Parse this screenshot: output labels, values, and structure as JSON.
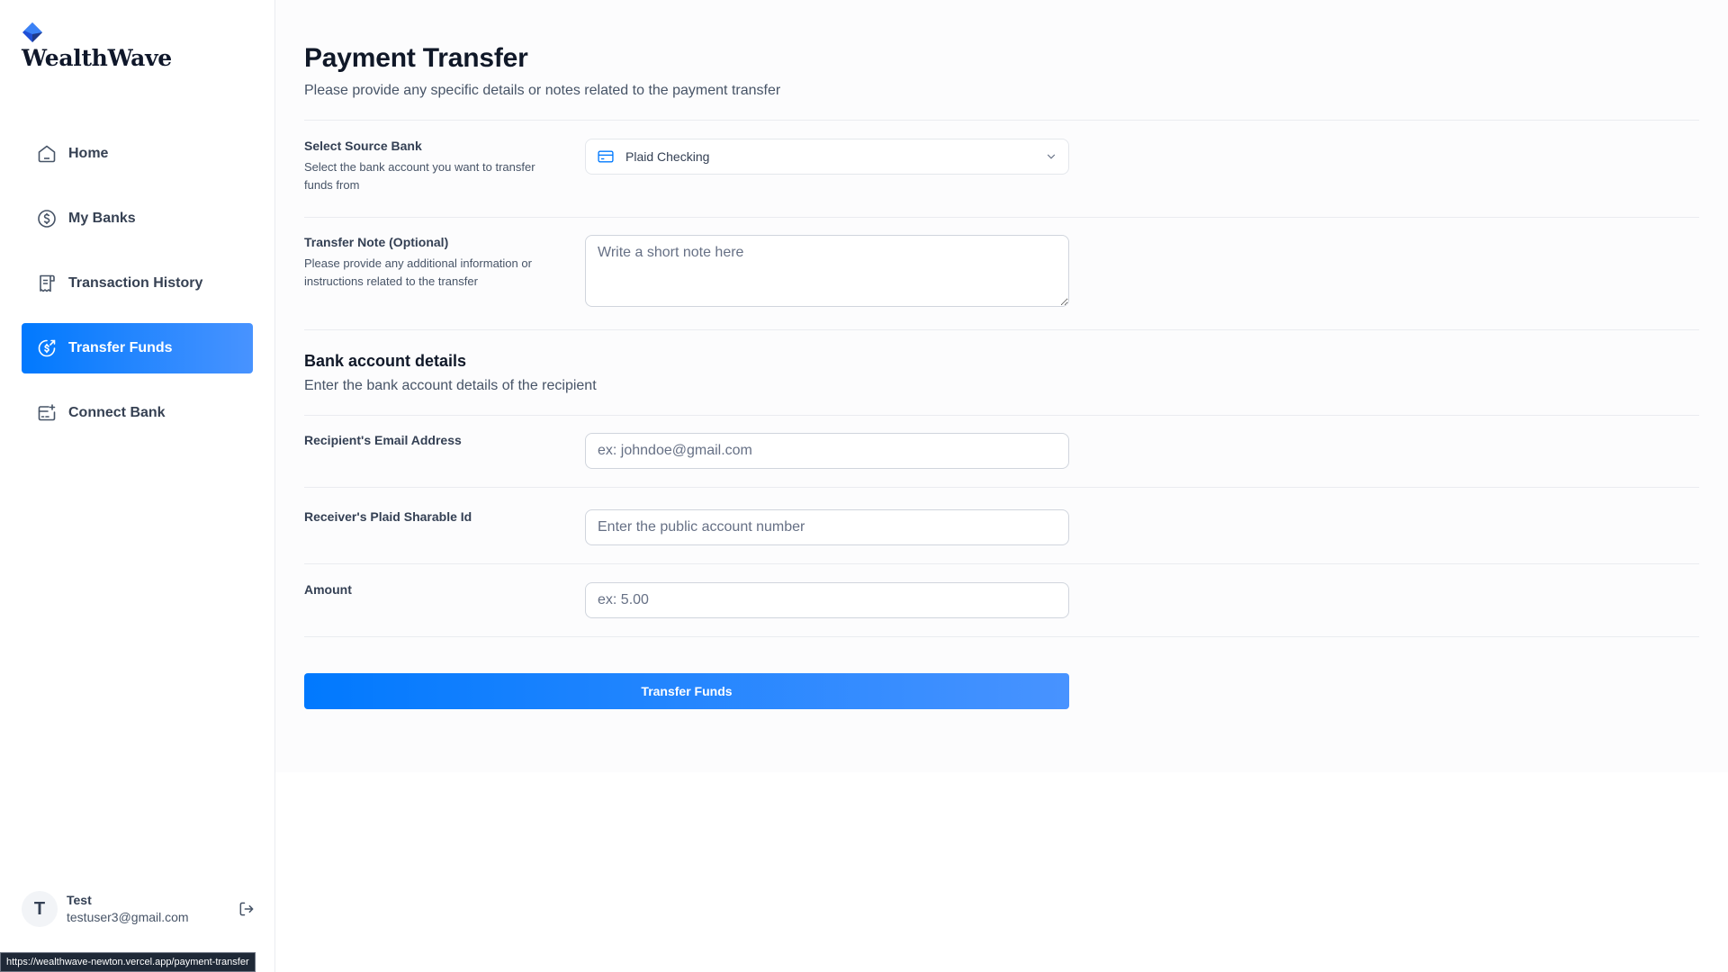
{
  "app": {
    "name": "WealthWave"
  },
  "sidebar": {
    "items": [
      {
        "label": "Home",
        "icon": "home-icon",
        "active": false
      },
      {
        "label": "My Banks",
        "icon": "dollar-circle-icon",
        "active": false
      },
      {
        "label": "Transaction History",
        "icon": "receipt-icon",
        "active": false
      },
      {
        "label": "Transfer Funds",
        "icon": "money-send-icon",
        "active": true
      },
      {
        "label": "Connect Bank",
        "icon": "card-add-icon",
        "active": false
      }
    ],
    "user": {
      "initial": "T",
      "name": "Test",
      "email": "testuser3@gmail.com"
    }
  },
  "status_bar": {
    "url": "https://wealthwave-newton.vercel.app/payment-transfer"
  },
  "page": {
    "title": "Payment Transfer",
    "subtitle": "Please provide any specific details or notes related to the payment transfer"
  },
  "form": {
    "source_bank": {
      "label": "Select Source Bank",
      "description": "Select the bank account you want to transfer funds from",
      "selected": "Plaid Checking"
    },
    "note": {
      "label": "Transfer Note (Optional)",
      "description": "Please provide any additional information or instructions related to the transfer",
      "placeholder": "Write a short note here",
      "value": ""
    },
    "bank_section": {
      "title": "Bank account details",
      "subtitle": "Enter the bank account details of the recipient"
    },
    "email": {
      "label": "Recipient's Email Address",
      "placeholder": "ex: johndoe@gmail.com",
      "value": ""
    },
    "sharable_id": {
      "label": "Receiver's Plaid Sharable Id",
      "placeholder": "Enter the public account number",
      "value": ""
    },
    "amount": {
      "label": "Amount",
      "placeholder": "ex: 5.00",
      "value": ""
    },
    "submit_label": "Transfer Funds"
  },
  "colors": {
    "accent": "#0179FE",
    "accent_light": "#4893FF",
    "active_text": "#ffffff"
  }
}
